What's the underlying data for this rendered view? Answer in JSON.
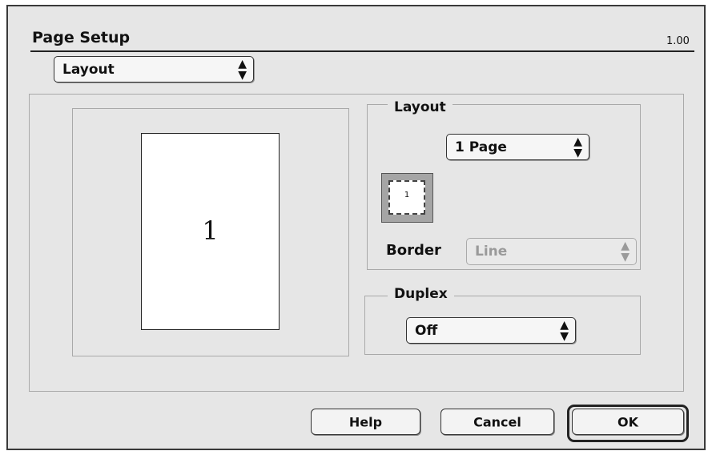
{
  "dialog": {
    "title": "Page Setup",
    "version": "1.00",
    "category_select": {
      "selected": "Layout"
    }
  },
  "preview": {
    "page_number": "1"
  },
  "layout_group": {
    "title": "Layout",
    "pages_select": {
      "selected": "1 Page"
    },
    "thumbnail_number": "1",
    "border_label": "Border",
    "border_select": {
      "selected": "Line",
      "disabled": true
    }
  },
  "duplex_group": {
    "title": "Duplex",
    "duplex_select": {
      "selected": "Off"
    }
  },
  "buttons": {
    "help": "Help",
    "cancel": "Cancel",
    "ok": "OK"
  },
  "icons": {
    "popup_arrows": "updown-arrows-icon"
  }
}
